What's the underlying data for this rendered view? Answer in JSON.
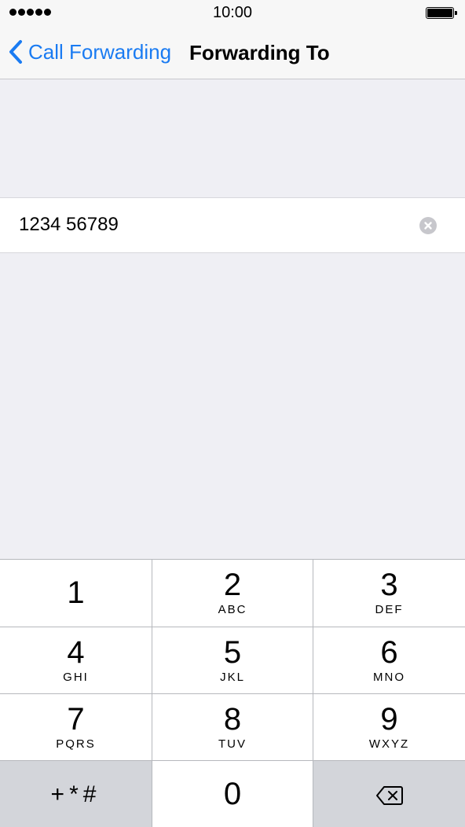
{
  "status": {
    "time": "10:00",
    "signal_icon": "signal-dots-icon",
    "battery_icon": "battery-icon"
  },
  "nav": {
    "back_label": "Call Forwarding",
    "title": "Forwarding To",
    "accent": "#1a7bf2"
  },
  "field": {
    "value": "1234 56789",
    "clear_icon": "clear-circle-icon"
  },
  "keypad": {
    "keys": [
      {
        "digit": "1",
        "letters": ""
      },
      {
        "digit": "2",
        "letters": "ABC"
      },
      {
        "digit": "3",
        "letters": "DEF"
      },
      {
        "digit": "4",
        "letters": "GHI"
      },
      {
        "digit": "5",
        "letters": "JKL"
      },
      {
        "digit": "6",
        "letters": "MNO"
      },
      {
        "digit": "7",
        "letters": "PQRS"
      },
      {
        "digit": "8",
        "letters": "TUV"
      },
      {
        "digit": "9",
        "letters": "WXYZ"
      },
      {
        "digit": "0",
        "letters": ""
      }
    ],
    "symbols_label": "+*#",
    "delete_icon": "backspace-icon"
  }
}
